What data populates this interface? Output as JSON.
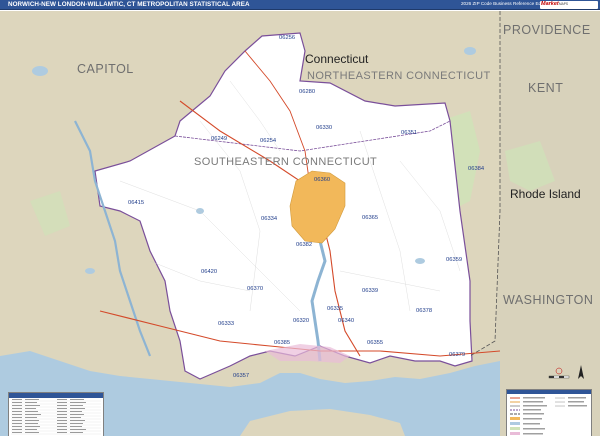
{
  "header": {
    "title": "NORWICH-NEW LONDON-WILLAMTIC, CT METROPOLITAN STATISTICAL AREA",
    "edition": "2026 ZIP Code Business Reference Edition"
  },
  "brand": {
    "logo": "Market",
    "sub": "MAPS"
  },
  "regions": {
    "connecticut": "Connecticut",
    "northeastern": "NORTHEASTERN CONNECTICUT",
    "capitol": "CAPITOL",
    "southeastern": "SOUTHEASTERN CONNECTICUT",
    "providence": "PROVIDENCE",
    "kent": "KENT",
    "rhode_island": "Rhode Island",
    "washington": "WASHINGTON"
  },
  "zips": {
    "z06256": "06256",
    "z06280": "06280",
    "z06254": "06254",
    "z06249": "06249",
    "z06330": "06330",
    "z06351": "06351",
    "z06384": "06384",
    "z06415": "06415",
    "z06334": "06334",
    "z06360": "06360",
    "z06365": "06365",
    "z06382": "06382",
    "z06420": "06420",
    "z06370": "06370",
    "z06339": "06339",
    "z06359": "06359",
    "z06335": "06335",
    "z06378": "06378",
    "z06333": "06333",
    "z06320": "06320",
    "z06340": "06340",
    "z06385": "06385",
    "z06355": "06355",
    "z06379": "06379",
    "z06357": "06357"
  },
  "colors": {
    "title_bar": "#2f5597",
    "land_out": "#ddd6bd",
    "land_in": "#ffffff",
    "water": "#aecbe0",
    "urban": "#f2b85a",
    "zip_text": "#1f3c8a",
    "boundary": "#7a4f9a",
    "park": "#cfe3b8"
  }
}
